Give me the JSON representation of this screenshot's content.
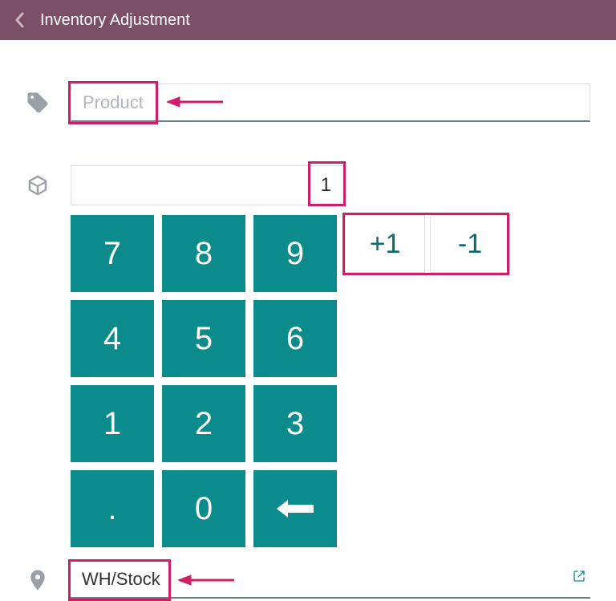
{
  "header": {
    "title": "Inventory Adjustment"
  },
  "product": {
    "placeholder": "Product",
    "value": ""
  },
  "quantity": {
    "value": "1"
  },
  "numpad": {
    "keys": [
      "7",
      "8",
      "9",
      "4",
      "5",
      "6",
      "1",
      "2",
      "3",
      ".",
      "0"
    ],
    "plus": "+1",
    "minus": "-1"
  },
  "location": {
    "value": "WH/Stock"
  }
}
